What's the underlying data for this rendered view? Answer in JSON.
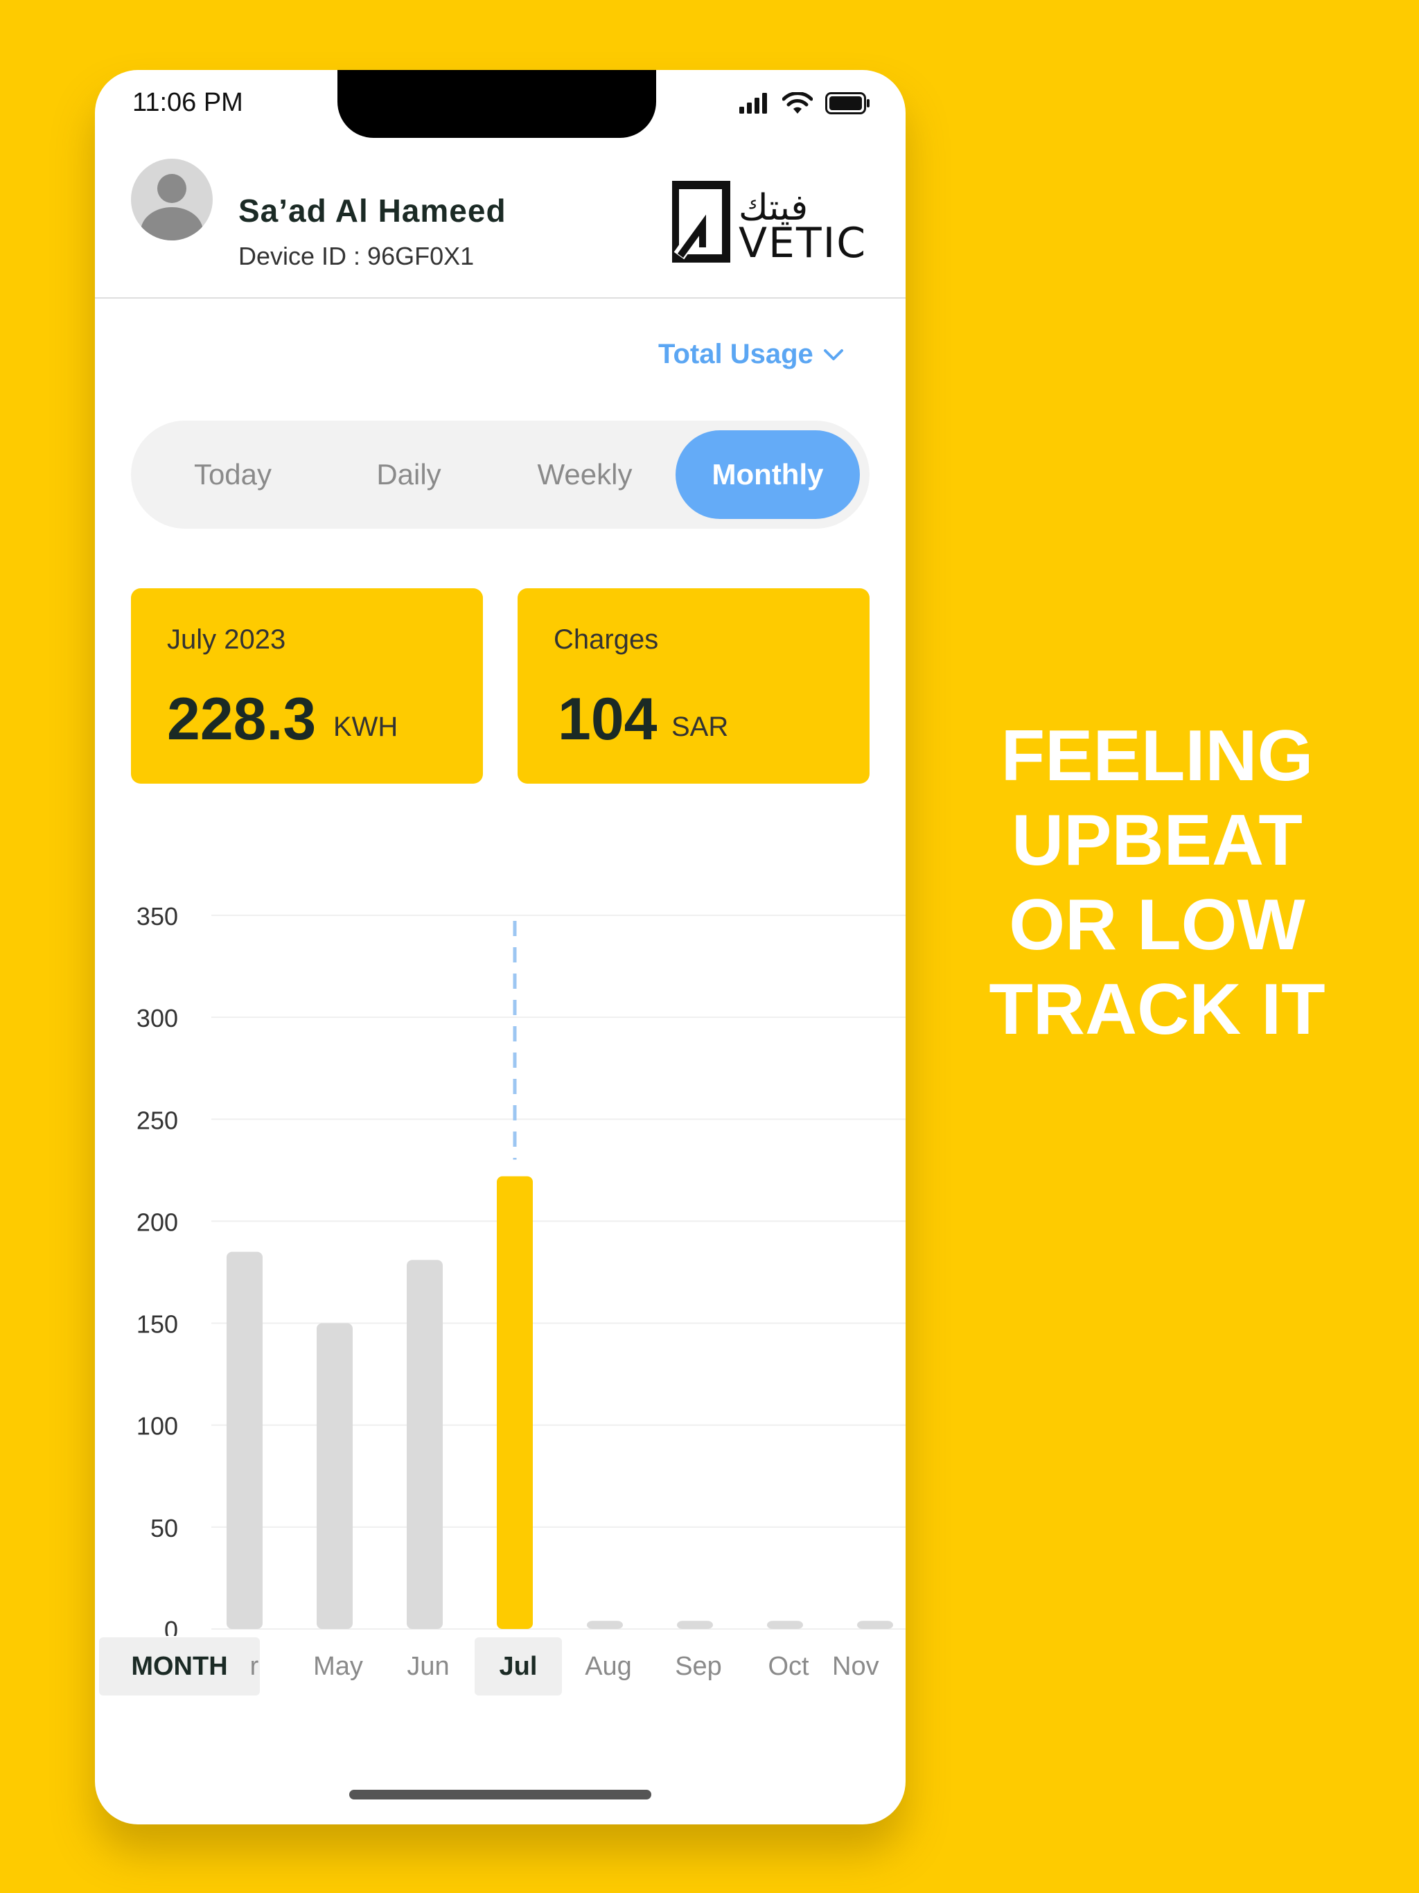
{
  "status_bar": {
    "time": "11:06 PM"
  },
  "header": {
    "user_name": "Sa’ad Al Hameed",
    "device_id": "Device ID : 96GF0X1",
    "logo_text_arabic": "فيتك",
    "logo_text_latin": "VETIC"
  },
  "usage_select": {
    "label": "Total Usage"
  },
  "tabs": [
    {
      "label": "Today",
      "active": false
    },
    {
      "label": "Daily",
      "active": false
    },
    {
      "label": "Weekly",
      "active": false
    },
    {
      "label": "Monthly",
      "active": true
    }
  ],
  "cards": {
    "usage": {
      "label": "July 2023",
      "value": "228.3",
      "unit": "KWH"
    },
    "charges": {
      "label": "Charges",
      "value": "104",
      "unit": "SAR"
    }
  },
  "chart_data": {
    "type": "bar",
    "categories": [
      "Apr",
      "May",
      "Jun",
      "Jul",
      "Aug",
      "Sep",
      "Oct",
      "Nov"
    ],
    "values": [
      185,
      150,
      181,
      222,
      4,
      4,
      4,
      4
    ],
    "highlight_index": 3,
    "y_ticks": [
      "350",
      "300",
      "250",
      "200",
      "150",
      "100",
      "50",
      "0"
    ],
    "ylim": [
      0,
      350
    ],
    "grid": true,
    "colors": {
      "bar": "#DADADA",
      "highlight": "#FECB00",
      "marker": "#9CC6F2"
    }
  },
  "month_strip": {
    "tag": "MONTH",
    "items": [
      "r",
      "May",
      "Jun",
      "Jul",
      "Aug",
      "Sep",
      "Oct",
      "Nov"
    ],
    "active_index": 3
  },
  "tagline": {
    "lines": [
      "FEELING",
      "UPBEAT",
      "OR LOW",
      "TRACK IT"
    ]
  },
  "colors": {
    "background": "#FECB00",
    "accent_blue": "#64ABF7",
    "dark_text": "#1B2A25"
  }
}
